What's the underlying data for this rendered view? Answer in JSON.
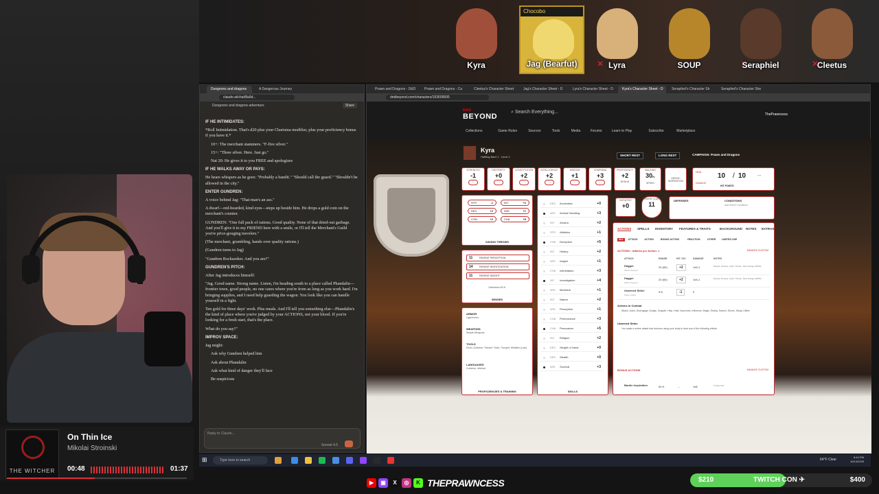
{
  "party": [
    {
      "name": "Kyra",
      "color": "#a0503a"
    },
    {
      "name": "Jag (Bearfut)",
      "tag": "Chocobo",
      "color": "#d9b43a"
    },
    {
      "name": "Lyra",
      "color": "#d8b07a"
    },
    {
      "name": "SOUP",
      "color": "#b8862a"
    },
    {
      "name": "Seraphiel",
      "color": "#5a3a2a"
    },
    {
      "name": "Cleetus",
      "color": "#8a5a3a"
    }
  ],
  "now_playing": {
    "album_art_text": "THE WITCHER",
    "title": "On Thin Ice",
    "artist": "Mikolai Stroinski",
    "elapsed": "00:48",
    "duration": "01:37",
    "progress": 0.49
  },
  "claude": {
    "tabs": [
      "Dungeons and dragons",
      "A Dangerous Journey"
    ],
    "url": "claude.ai/chat/8a9d...",
    "chat_title": "Dungeons and dragons adventure",
    "share": "Share",
    "messages": {
      "h1": "IF HE INTIMIDATES:",
      "p1": "*Roll Intimidation. That's d20 plus your Charisma modifier, plus your proficiency bonus if you have it.*",
      "b1": "10+: The merchant stammers. \"F-five silver.\"",
      "b2": "15+: \"Three silver. Here. Just go.\"",
      "b3": "Nat 20: He gives it to you FREE and apologizes",
      "h2": "IF HE WALKS AWAY OR PAYS:",
      "p2": "He hears whispers as he goes: \"Probably a bandit.\" \"Should call the guard.\" \"Shouldn't be allowed in the city.\"",
      "h3": "ENTER GUNDREN:",
      "p3": "A voice behind Jag: \"That man's an ass.\"",
      "p4": "A dwarf—red-bearded, kind eyes—steps up beside him. He drops a gold coin on the merchant's counter.",
      "p5": "GUNDREN: \"One full pack of rations. Good quality. None of that dried-out garbage. And you'll give it to my FRIEND here with a smile, or I'll tell the Merchant's Guild you're price-gouging travelers.\"",
      "p6": "(The merchant, grumbling, hands over quality rations.)",
      "p7": "(Gundren turns to Jag)",
      "p8": "\"Gundren Rockseeker. And you are?\"",
      "h4": "GUNDREN'S PITCH:",
      "p9": "After Jag introduces himself:",
      "p10": "\"Jag. Good name. Strong name. Listen, I'm heading south to a place called Phandalin—frontier town, good people, no one cares where you're from as long as you work hard. I'm bringing supplies, and I need help guarding the wagon. You look like you can handle yourself in a fight.",
      "p11": "Ten gold for three days' work. Plus meals. And I'll tell you something else—Phandalin's the kind of place where you're judged by your ACTIONS, not your blood. If you're looking for a fresh start, that's the place.",
      "p12": "What do you say?\"",
      "h5": "IMPROV SPACE:",
      "p13": "Jag might:",
      "b4": "Ask why Gundren helped him",
      "b5": "Ask about Phandalin",
      "b6": "Ask what kind of danger they'll face",
      "b7": "Be suspicious"
    },
    "reply_placeholder": "Reply to Claude...",
    "model": "Sonnet 4.5"
  },
  "dnd": {
    "tabs": [
      "Prawn and Dragons - D&D",
      "Prawn and Dragons - Ca",
      "Cleetus's Character Sheet",
      "Jag's Character Sheet - D",
      "Lyra's Character Sheet - D",
      "Kyra's Character Sheet - D",
      "Seraphiel's Character Sh",
      "Seraphiel's Character She"
    ],
    "url": "dndbeyond.com/characters/153609595",
    "logo": "BEYOND",
    "logo_small": "D&D",
    "search": "Search Everything...",
    "user": "ThePrawncess",
    "menu": [
      "Collections",
      "Game Rules",
      "Sources",
      "Tools",
      "Media",
      "Forums",
      "Learn to Play",
      "Subscribe",
      "Marketplace"
    ],
    "character": {
      "name": "Kyra",
      "subtitle": "Halfling Bard 1",
      "level": "Level 1",
      "short_rest": "SHORT REST",
      "long_rest": "LONG REST",
      "campaign": "CAMPAIGN: Prawn and Dragons",
      "abilities": [
        {
          "label": "STRENGTH",
          "mod": "-1",
          "score": "8"
        },
        {
          "label": "DEXTERITY",
          "mod": "+0",
          "score": "10"
        },
        {
          "label": "CONSTITUTION",
          "mod": "+2",
          "score": "14"
        },
        {
          "label": "INTELLIGENCE",
          "mod": "+2",
          "score": "14"
        },
        {
          "label": "WISDOM",
          "mod": "+1",
          "score": "12"
        },
        {
          "label": "CHARISMA",
          "mod": "+3",
          "score": "17"
        }
      ],
      "proficiency": {
        "label": "PROFICIENCY",
        "value": "+2",
        "sub": "BONUS"
      },
      "speed": {
        "label": "WALKING",
        "value": "30",
        "unit": "ft.",
        "sub": "SPEED"
      },
      "heroic": "HEROIC INSPIRATION",
      "hp": {
        "label": "HIT POINTS",
        "current": "10",
        "max": "10",
        "temp": "--",
        "heal": "HEAL",
        "damage": "DAMAGE"
      },
      "initiative": {
        "label": "INITIATIVE",
        "value": "+0"
      },
      "ac": {
        "label": "ARMOR CLASS",
        "value": "11"
      },
      "defenses": "DEFENSES",
      "conditions": "CONDITIONS",
      "add_conditions": "Add Active Conditions",
      "saves": [
        {
          "ab": "STR",
          "v": "-1"
        },
        {
          "ab": "INT",
          "v": "+2"
        },
        {
          "ab": "DEX",
          "v": "+2"
        },
        {
          "ab": "WIS",
          "v": "+1"
        },
        {
          "ab": "CON",
          "v": "+2"
        },
        {
          "ab": "CHA",
          "v": "+5"
        }
      ],
      "saving_throws": "SAVING THROWS",
      "senses": [
        {
          "v": "11",
          "t": "PASSIVE PERCEPTION"
        },
        {
          "v": "14",
          "t": "PASSIVE INVESTIGATION"
        },
        {
          "v": "11",
          "t": "PASSIVE INSIGHT"
        }
      ],
      "darkvision": "Darkvision 60 ft.",
      "senses_label": "SENSES",
      "armor_label": "ARMOR",
      "armor": "Light Armor",
      "weapons_label": "WEAPONS",
      "weapons": "Simple Weapons",
      "tools_label": "TOOLS",
      "tools": "Drum, Dulcimer, Thieves' Tools, Trumpet, Whistles (Lute)",
      "languages_label": "LANGUAGES",
      "languages": "Common, Infernal",
      "prof_training": "PROFICIENCIES & TRAINING",
      "skills_label": "SKILLS",
      "skills": [
        {
          "ab": "DEX",
          "name": "Acrobatics",
          "bonus": "+0",
          "prof": false
        },
        {
          "ab": "WIS",
          "name": "Animal Handling",
          "bonus": "+3",
          "prof": true
        },
        {
          "ab": "INT",
          "name": "Arcana",
          "bonus": "+2",
          "prof": false
        },
        {
          "ab": "STR",
          "name": "Athletics",
          "bonus": "+1",
          "prof": false
        },
        {
          "ab": "CHA",
          "name": "Deception",
          "bonus": "+5",
          "prof": true
        },
        {
          "ab": "INT",
          "name": "History",
          "bonus": "+2",
          "prof": false
        },
        {
          "ab": "WIS",
          "name": "Insight",
          "bonus": "+1",
          "prof": false
        },
        {
          "ab": "CHA",
          "name": "Intimidation",
          "bonus": "+3",
          "prof": false
        },
        {
          "ab": "INT",
          "name": "Investigation",
          "bonus": "+4",
          "prof": true
        },
        {
          "ab": "WIS",
          "name": "Medicine",
          "bonus": "+1",
          "prof": false
        },
        {
          "ab": "INT",
          "name": "Nature",
          "bonus": "+2",
          "prof": false
        },
        {
          "ab": "WIS",
          "name": "Perception",
          "bonus": "+1",
          "prof": false
        },
        {
          "ab": "CHA",
          "name": "Performance",
          "bonus": "+3",
          "prof": false
        },
        {
          "ab": "CHA",
          "name": "Persuasion",
          "bonus": "+5",
          "prof": true
        },
        {
          "ab": "INT",
          "name": "Religion",
          "bonus": "+2",
          "prof": false
        },
        {
          "ab": "DEX",
          "name": "Sleight of Hand",
          "bonus": "+0",
          "prof": false
        },
        {
          "ab": "DEX",
          "name": "Stealth",
          "bonus": "+0",
          "prof": false
        },
        {
          "ab": "WIS",
          "name": "Survival",
          "bonus": "+3",
          "prof": true
        }
      ],
      "action_tabs": [
        "ACTIONS",
        "SPELLS",
        "INVENTORY",
        "FEATURES & TRAITS",
        "BACKGROUND",
        "NOTES",
        "EXTRAS"
      ],
      "filter_tabs": [
        "ALL",
        "ATTACK",
        "ACTION",
        "BONUS ACTION",
        "REACTION",
        "OTHER",
        "LIMITED USE"
      ],
      "actions_header": "ACTIONS • Attacks per Action: 1",
      "manage_custom": "MANAGE CUSTOM",
      "col_attack": "ATTACK",
      "col_range": "RANGE",
      "col_hit": "HIT / DC",
      "col_damage": "DAMAGE",
      "col_notes": "NOTES",
      "attacks": [
        {
          "name": "Dagger",
          "sub": "Melee Weapon",
          "range": "20 (60)",
          "hit": "+2",
          "dmg": "1d4-1",
          "notes": "Simple, Finesse, Light, Thrown, Nick, Range (20/60)"
        },
        {
          "name": "Dagger",
          "sub": "Melee Weapon",
          "range": "20 (60)",
          "hit": "+2",
          "dmg": "1d4-1",
          "notes": "Simple, Finesse, Light, Thrown, Nick, Range (20/60)"
        },
        {
          "name": "Unarmed Strike",
          "sub": "Melee Attack",
          "range": "5 ft.",
          "hit": "-1",
          "dmg": "0",
          "notes": ""
        }
      ],
      "combat_title": "Actions in Combat",
      "combat_text": "Attack, Dash, Disengage, Dodge, Grapple, Help, Hide, Improvise, Influence, Magic, Ready, Search, Shove, Study, Utilize",
      "unarmed_title": "Unarmed Strike",
      "unarmed_text": "You make a melee attack that involves using your body to deal one of the following effects",
      "bonus_actions": "BONUS ACTIONS",
      "bardic": {
        "name": "Bardic Inspiration",
        "range": "60 ft.",
        "hit": "--",
        "dmg": "1d6",
        "notes": "3 Uses /LR"
      }
    }
  },
  "taskbar": {
    "search": "Type here to search",
    "weather": "64°F Clear",
    "time": "8:44 PM",
    "date": "10/14/2025"
  },
  "social": {
    "handle": "THEPRAWNCESS"
  },
  "goal": {
    "current": "$210",
    "label": "TWITCH CON ✈",
    "target": "$400",
    "progress": 0.525
  }
}
